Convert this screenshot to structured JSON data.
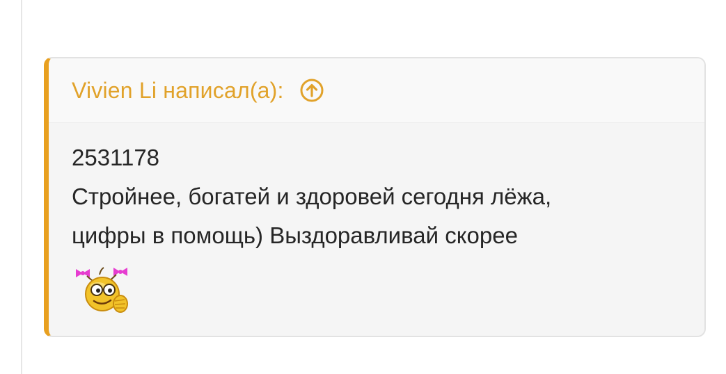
{
  "quote": {
    "author": "Vivien Li",
    "wrote": "написал(а):",
    "lines": [
      "2531178",
      "Стройнее, богатей и здоровей сегодня лёжа,",
      "цифры в помощь) Выздоравливай скорее"
    ],
    "accent_color": "#e8a020",
    "header_icon": "arrow-up-circle-icon",
    "emoticon": "smiley-emoticon"
  }
}
